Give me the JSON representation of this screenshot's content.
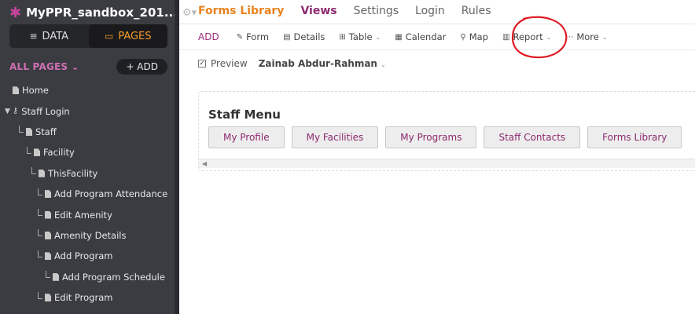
{
  "app": {
    "title": "MyPPR_sandbox_201...",
    "toggle": {
      "data_label": "DATA",
      "pages_label": "PAGES"
    },
    "all_pages_label": "ALL PAGES",
    "add_label": "+ ADD"
  },
  "tree": [
    {
      "label": "Home"
    },
    {
      "label": "Staff Login"
    },
    {
      "label": "Staff"
    },
    {
      "label": "Facility"
    },
    {
      "label": "ThisFacility"
    },
    {
      "label": "Add Program Attendance"
    },
    {
      "label": "Edit Amenity"
    },
    {
      "label": "Amenity Details"
    },
    {
      "label": "Add Program"
    },
    {
      "label": "Add Program Schedule"
    },
    {
      "label": "Edit Program"
    }
  ],
  "topnav": {
    "brand": "Forms Library",
    "views": "Views",
    "settings": "Settings",
    "login": "Login",
    "rules": "Rules"
  },
  "toolbar": {
    "add": "ADD",
    "form": "Form",
    "details": "Details",
    "table": "Table",
    "calendar": "Calendar",
    "map": "Map",
    "report": "Report",
    "more": "More"
  },
  "preview": {
    "label": "Preview",
    "user": "Zainab Abdur-Rahman"
  },
  "menu": {
    "title": "Staff Menu",
    "buttons": [
      "My Profile",
      "My Facilities",
      "My Programs",
      "Staff Contacts",
      "Forms Library"
    ]
  },
  "colors": {
    "sidebar_bg": "#3a3c42",
    "accent_orange": "#f39c2c",
    "accent_purple": "#8e2a6e",
    "annotation_red": "#e01b24"
  }
}
